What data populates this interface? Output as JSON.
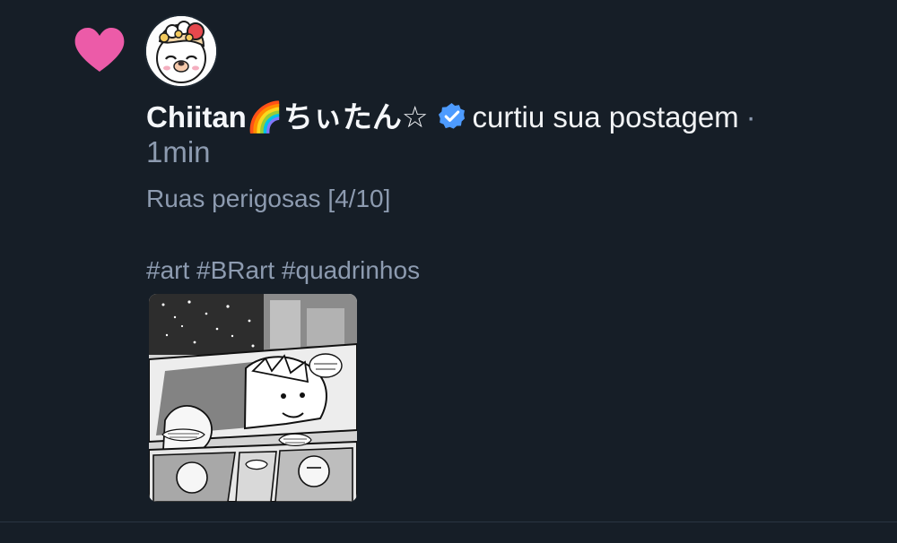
{
  "notification": {
    "author_name": "Chiitan🌈ちぃたん☆",
    "action_text": "curtiu sua postagem",
    "separator": "·",
    "time": "1min",
    "post_text": "Ruas perigosas [4/10]\n\n#art #BRart #quadrinhos",
    "icons": {
      "like": "heart-icon",
      "verified": "verified-check-icon"
    },
    "colors": {
      "background": "#161e27",
      "heart": "#ec5ba8",
      "verified": "#4d9bff",
      "muted_text": "#8d9bb0",
      "primary_text": "#f1f3f5"
    }
  }
}
